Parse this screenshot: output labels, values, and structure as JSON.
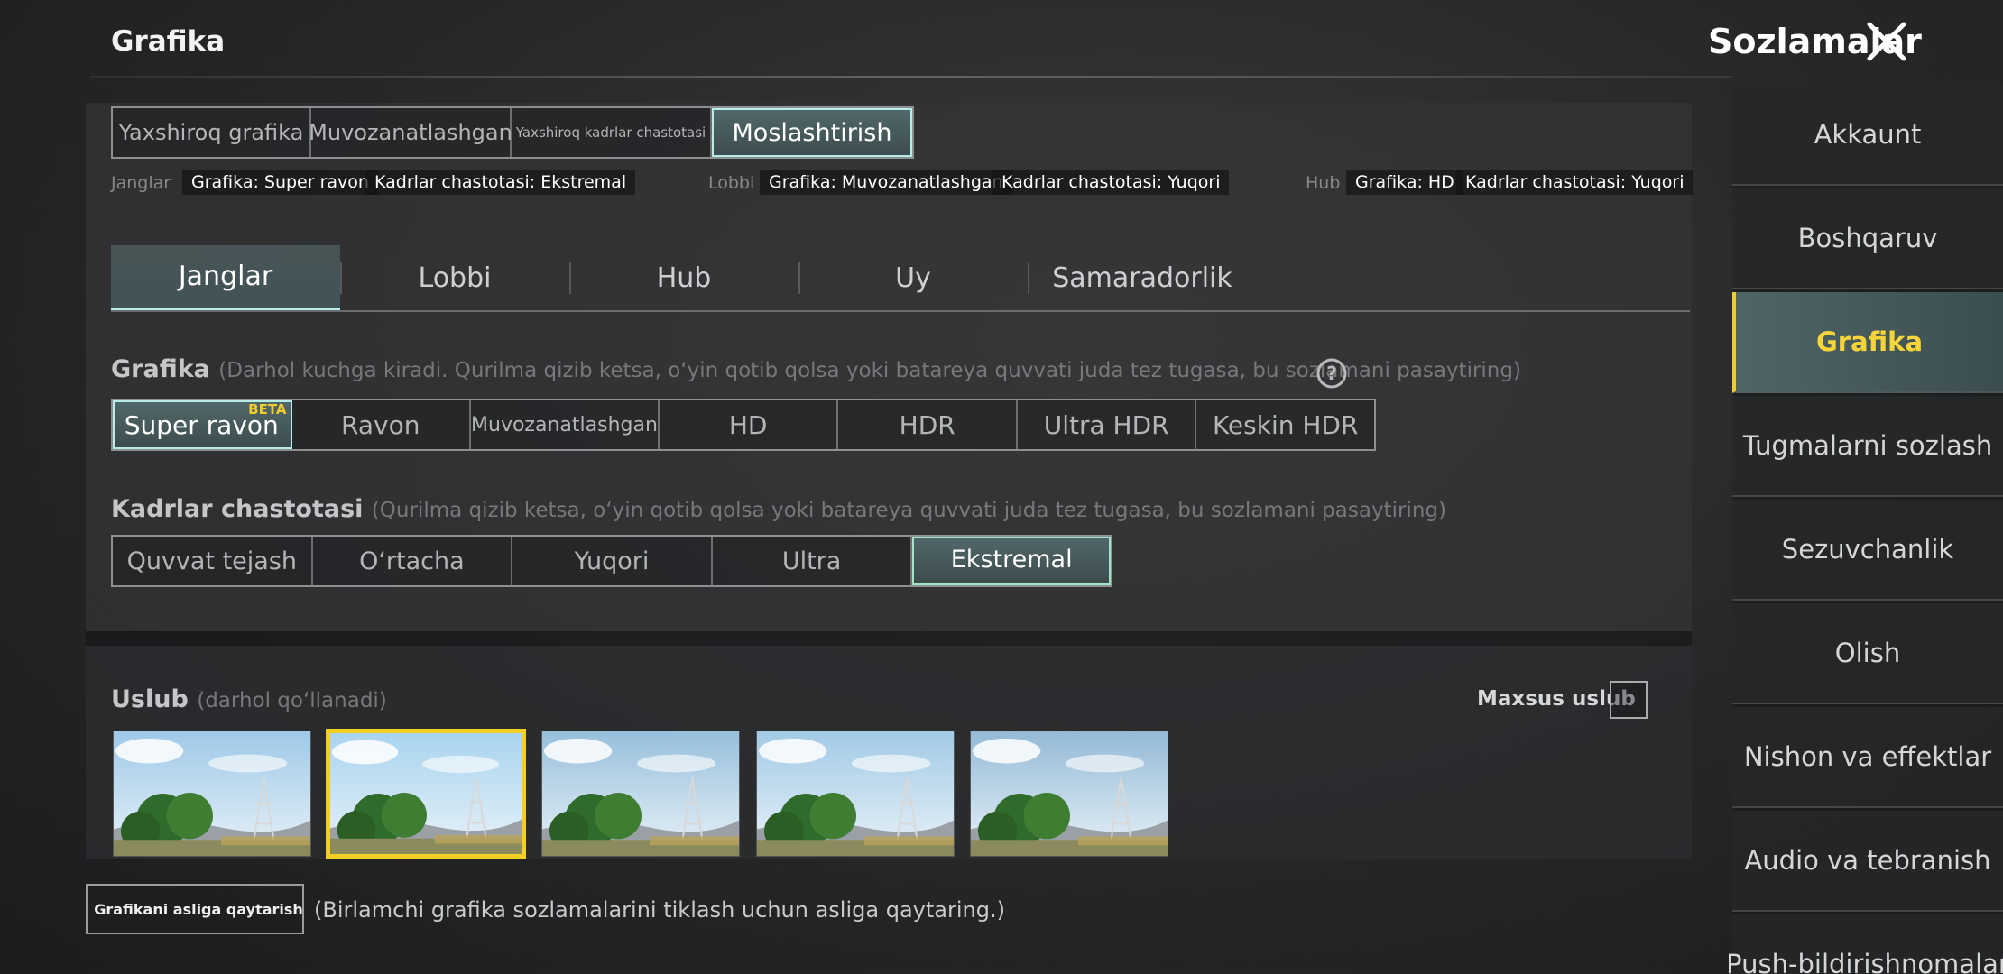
{
  "header": {
    "page_title": "Grafika",
    "settings_title": "Sozlamalar"
  },
  "presets": [
    {
      "label": "Yaxshiroq grafika",
      "active": false
    },
    {
      "label": "Muvozanatlashgan",
      "active": false
    },
    {
      "label": "Yaxshiroq kadrlar chastotasi",
      "active": false
    },
    {
      "label": "Moslashtirish",
      "active": true
    }
  ],
  "mode_info": {
    "battles": {
      "label": "Janglar",
      "graphics": "Grafika: Super ravon",
      "fps": "Kadrlar chastotasi: Ekstremal"
    },
    "lobby": {
      "label": "Lobbi",
      "graphics": "Grafika: Muvozanatlashgan",
      "fps": "Kadrlar chastotasi: Yuqori"
    },
    "hub": {
      "label": "Hub",
      "graphics": "Grafika: HD",
      "fps": "Kadrlar chastotasi: Yuqori"
    }
  },
  "tabs": [
    {
      "label": "Janglar",
      "active": true
    },
    {
      "label": "Lobbi",
      "active": false
    },
    {
      "label": "Hub",
      "active": false
    },
    {
      "label": "Uy",
      "active": false
    },
    {
      "label": "Samaradorlik",
      "active": false
    }
  ],
  "graphics_section": {
    "label": "Grafika",
    "note": "(Darhol kuchga kiradi. Qurilma qizib ketsa, o‘yin qotib qolsa yoki batareya quvvati juda tez tugasa, bu sozlamani pasaytiring)",
    "beta_badge": "BETA",
    "options": [
      {
        "label": "Super ravon",
        "active": true
      },
      {
        "label": "Ravon",
        "active": false
      },
      {
        "label": "Muvozanatlashgan",
        "active": false
      },
      {
        "label": "HD",
        "active": false
      },
      {
        "label": "HDR",
        "active": false
      },
      {
        "label": "Ultra HDR",
        "active": false
      },
      {
        "label": "Keskin HDR",
        "active": false
      }
    ]
  },
  "fps_section": {
    "label": "Kadrlar chastotasi",
    "note": "(Qurilma qizib ketsa, o‘yin qotib qolsa yoki batareya quvvati juda tez tugasa, bu sozlamani pasaytiring)",
    "options": [
      {
        "label": "Quvvat tejash",
        "active": false
      },
      {
        "label": "O‘rtacha",
        "active": false
      },
      {
        "label": "Yuqori",
        "active": false
      },
      {
        "label": "Ultra",
        "active": false
      },
      {
        "label": "Ekstremal",
        "active": true
      }
    ]
  },
  "style_section": {
    "label": "Uslub",
    "note": "(darhol qo‘llanadi)",
    "custom_label": "Maxsus uslub",
    "selected_index": 1,
    "thumb_count": 5
  },
  "reset": {
    "button_label": "Grafikani asliga qaytarish",
    "note": "(Birlamchi grafika sozlamalarini tiklash uchun asliga qaytaring.)"
  },
  "sidebar": {
    "items": [
      {
        "label": "Akkaunt",
        "active": false
      },
      {
        "label": "Boshqaruv",
        "active": false
      },
      {
        "label": "Grafika",
        "active": true
      },
      {
        "label": "Tugmalarni sozlash",
        "active": false
      },
      {
        "label": "Sezuvchanlik",
        "active": false
      },
      {
        "label": "Olish",
        "active": false
      },
      {
        "label": "Nishon va effektlar",
        "active": false
      },
      {
        "label": "Audio va tebranish",
        "active": false
      },
      {
        "label": "Push-bildirishnomalar",
        "active": false
      }
    ]
  },
  "colors": {
    "accent_cyan": "#b6ede9",
    "accent_yellow": "#f2cf22",
    "fps_active_green": "#46c37a"
  }
}
